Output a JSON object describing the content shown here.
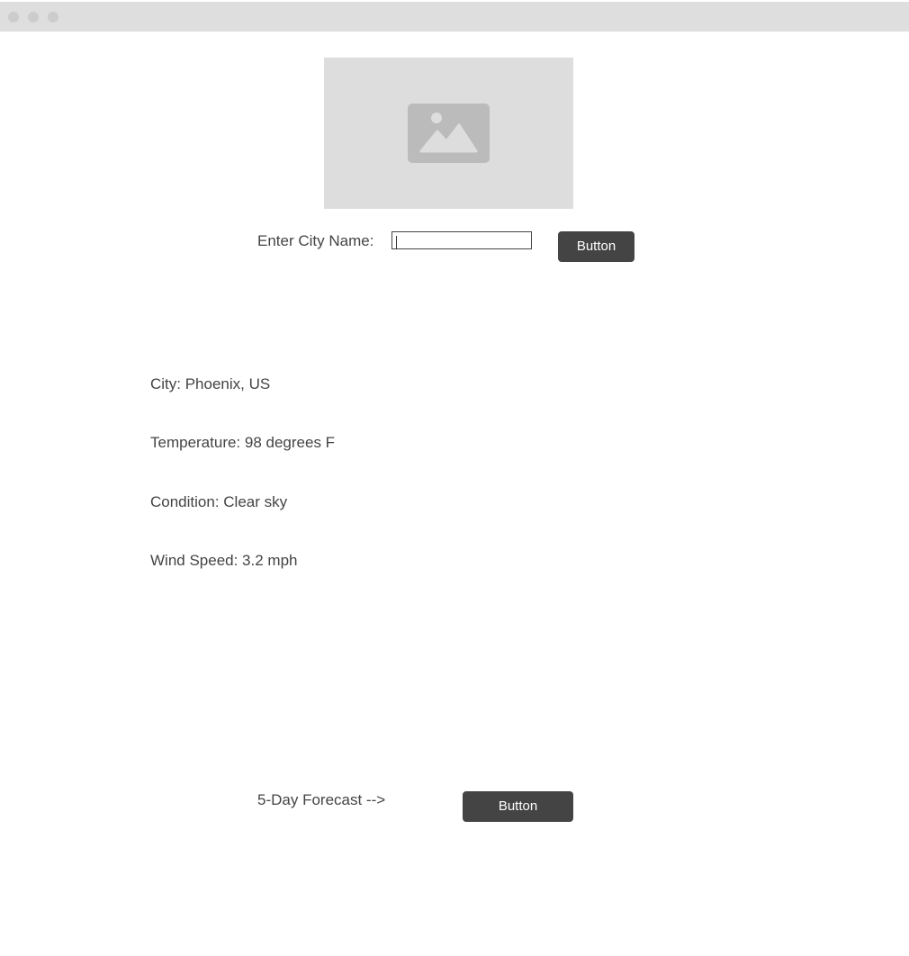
{
  "search": {
    "label": "Enter City Name:",
    "value": "",
    "button_label": "Button"
  },
  "weather": {
    "city": "City: Phoenix, US",
    "temperature": "Temperature: 98 degrees F",
    "condition": "Condition: Clear sky",
    "wind_speed": "Wind Speed: 3.2 mph"
  },
  "forecast": {
    "label": "5-Day Forecast -->",
    "button_label": "Button"
  },
  "icons": {
    "window_controls": [
      "window-dot-icon",
      "window-dot-icon",
      "window-dot-icon"
    ],
    "placeholder": "image-icon"
  },
  "colors": {
    "button_bg": "#444444",
    "button_text": "#ffffff",
    "text": "#444444",
    "placeholder_bg": "#dddddd",
    "titlebar_bg": "#dedede"
  }
}
